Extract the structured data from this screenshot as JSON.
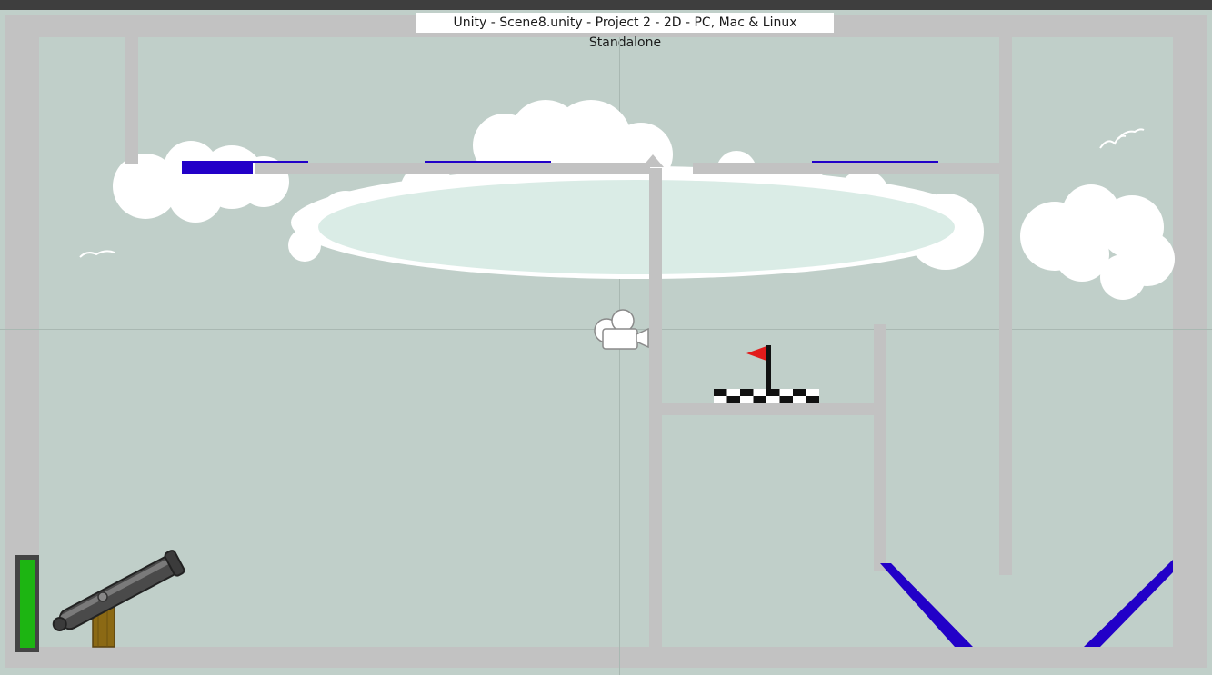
{
  "window": {
    "title": "Unity - Scene8.unity - Project 2 - 2D - PC, Mac & Linux Standalone"
  },
  "colors": {
    "sky": "#c0cfc9",
    "wall": "#c2c2c2",
    "platform_blue": "#2200c8",
    "power_meter": "#1db512",
    "flag": "#e21b1b"
  },
  "icons": {
    "scene_camera": "camera-icon",
    "goal": "flag-icon",
    "player": "cannon-icon"
  },
  "power_meter": {
    "level": 1.0
  }
}
